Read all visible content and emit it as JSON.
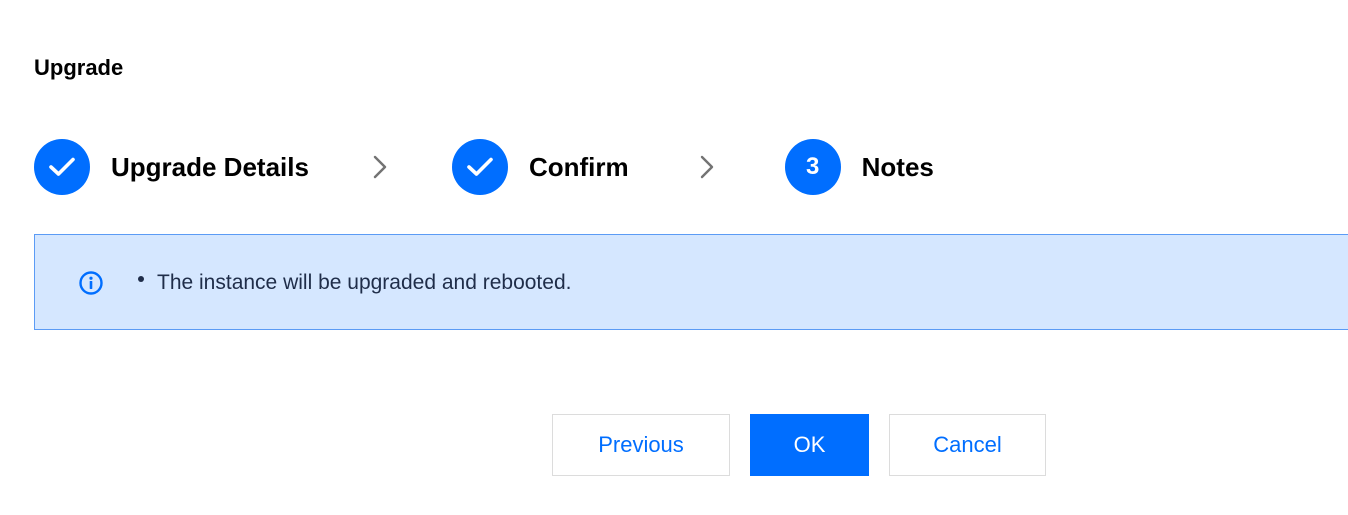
{
  "dialog": {
    "title": "Upgrade"
  },
  "steps": [
    {
      "label": "Upgrade Details",
      "state": "done",
      "badge": "",
      "icon": "check-icon"
    },
    {
      "label": "Confirm",
      "state": "done",
      "badge": "",
      "icon": "check-icon"
    },
    {
      "label": "Notes",
      "state": "current",
      "badge": "3",
      "icon": ""
    }
  ],
  "step_separator_icon": "chevron-right-icon",
  "alert": {
    "icon": "info-icon",
    "items": [
      "The instance will be upgraded and rebooted."
    ]
  },
  "buttons": {
    "previous": "Previous",
    "ok": "OK",
    "cancel": "Cancel"
  },
  "colors": {
    "accent": "#006eff",
    "alert_background": "#d5e7ff",
    "alert_border": "#5b9bf5",
    "alert_text": "#1f2d49"
  }
}
